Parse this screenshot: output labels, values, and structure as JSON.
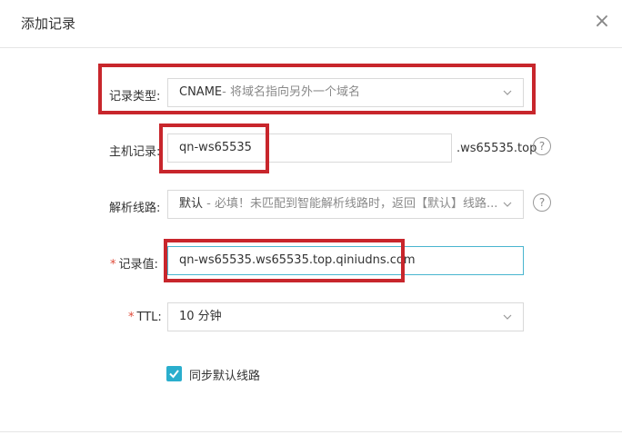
{
  "dialog": {
    "title": "添加记录",
    "close": "×"
  },
  "form": {
    "record_type": {
      "label": "记录类型:",
      "value": "CNAME",
      "hint": "- 将域名指向另外一个域名"
    },
    "host": {
      "label": "主机记录:",
      "value": "qn-ws65535",
      "suffix": ".ws65535.top",
      "help": "?"
    },
    "line": {
      "label": "解析线路:",
      "value": "默认",
      "hint": " - 必填！未匹配到智能解析线路时，返回【默认】线路...",
      "help": "?"
    },
    "record_value": {
      "required": "*",
      "label": "记录值:",
      "value": "qn-ws65535.ws65535.top.qiniudns.com"
    },
    "ttl": {
      "required": "*",
      "label": "TTL:",
      "value": "10 分钟"
    },
    "sync": {
      "label": "同步默认线路",
      "checked": true
    }
  },
  "colors": {
    "accent": "#2aaecd",
    "highlight_box": "#c8262c",
    "required": "#e04b3a"
  }
}
